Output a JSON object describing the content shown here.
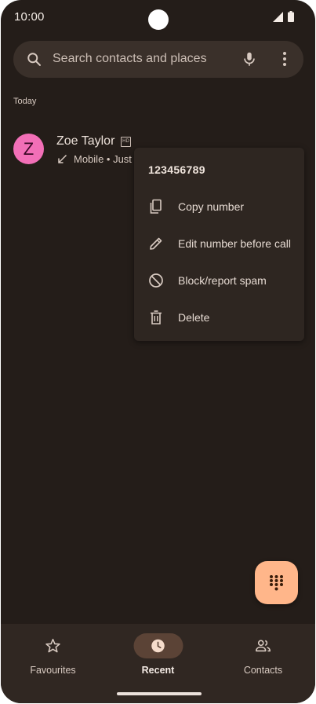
{
  "status_bar": {
    "time": "10:00",
    "icons": [
      "cellular-signal-icon",
      "battery-icon"
    ]
  },
  "search": {
    "placeholder": "Search contacts and places",
    "icons": [
      "search-icon",
      "microphone-icon",
      "more-vertical-icon"
    ]
  },
  "recents": {
    "section_header": "Today",
    "calls": [
      {
        "avatar_letter": "Z",
        "avatar_color": "#f26fb7",
        "name": "Zoe Taylor",
        "hd_badge": "HD",
        "detail": "Mobile • Just",
        "direction_icon": "incoming-call-arrow-icon"
      }
    ]
  },
  "context_menu": {
    "title": "123456789",
    "items": [
      {
        "label": "Copy number",
        "icon": "copy-icon"
      },
      {
        "label": "Edit number before call",
        "icon": "pencil-icon"
      },
      {
        "label": "Block/report spam",
        "icon": "block-icon"
      },
      {
        "label": "Delete",
        "icon": "trash-icon"
      }
    ]
  },
  "fab": {
    "icon": "dialpad-icon",
    "color": "#ffb68a"
  },
  "bottom_nav": {
    "items": [
      {
        "label": "Favourites",
        "icon": "star-icon",
        "active": false
      },
      {
        "label": "Recent",
        "icon": "clock-icon",
        "active": true
      },
      {
        "label": "Contacts",
        "icon": "people-icon",
        "active": false
      }
    ]
  },
  "colors": {
    "background": "#241d19",
    "surface": "#3a302a",
    "menu_surface": "#2e2621",
    "nav_surface": "#302722",
    "active_pill": "#5b4336",
    "accent": "#ffb68a"
  }
}
